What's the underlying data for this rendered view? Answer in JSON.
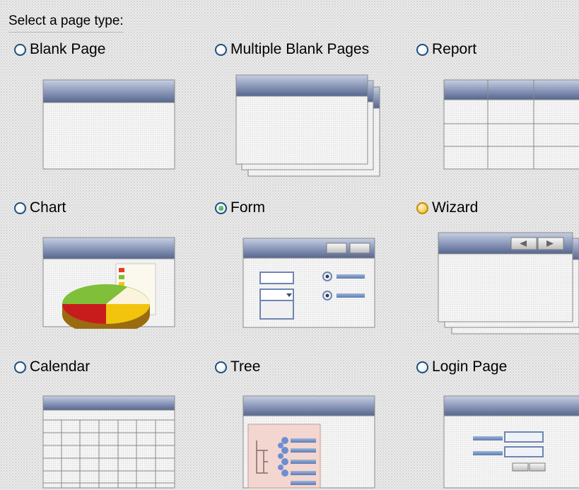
{
  "header": "Select a page type:",
  "options": [
    {
      "label": "Blank Page",
      "selected": false
    },
    {
      "label": "Multiple Blank Pages",
      "selected": false
    },
    {
      "label": "Report",
      "selected": false
    },
    {
      "label": "Chart",
      "selected": false
    },
    {
      "label": "Form",
      "selected": true
    },
    {
      "label": "Wizard",
      "selected": false,
      "hovered": true
    },
    {
      "label": "Calendar",
      "selected": false
    },
    {
      "label": "Tree",
      "selected": false
    },
    {
      "label": "Login Page",
      "selected": false
    }
  ],
  "colors": {
    "titlebar_dark": "#5d6e95",
    "titlebar_light": "#c7cfe2",
    "window_border": "#8a8a8a",
    "radio_border": "#1f4f7f",
    "radio_checked": "#1d8a3a",
    "radio_hover": "#d99d1c"
  }
}
